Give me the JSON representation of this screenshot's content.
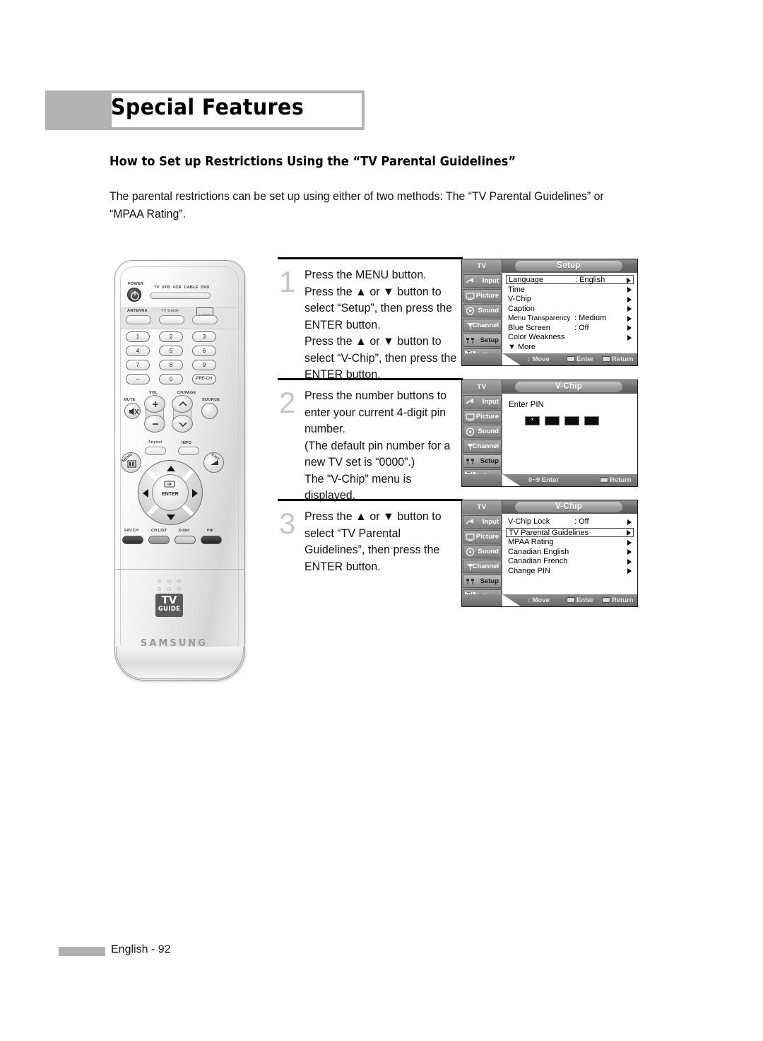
{
  "page": {
    "title": "Special Features",
    "section_heading": "How to Set up Restrictions Using the “TV Parental Guidelines”",
    "intro": "The parental restrictions can be set up using either of two methods: The “TV Parental Guidelines” or “MPAA Rating”.",
    "footer_text": "English - 92"
  },
  "remote": {
    "brand": "SAMSUNG",
    "power_label": "POWER",
    "device_modes": [
      "TV",
      "STB",
      "VCR",
      "CABLE",
      "DVD"
    ],
    "antenna_label": "ANTENNA",
    "tvguide_label": "TV Guide",
    "mode_label": "MODE",
    "numbers": [
      "1",
      "2",
      "3",
      "4",
      "5",
      "6",
      "7",
      "8",
      "9",
      "–",
      "0",
      "PRE-CH"
    ],
    "mute_label": "MUTE",
    "vol_label": "VOL",
    "chpage_label": "CH/PAGE",
    "source_label": "SOURCE",
    "anynet_label": "Anynet",
    "info_label": "INFO",
    "menu_label": "MENU",
    "exit_label": "EXIT",
    "enter_label": "ENTER",
    "color_buttons": [
      "FAV.CH",
      "CH.LIST",
      "D-Net",
      "PIP"
    ],
    "tvguide_logo_top": "TV",
    "tvguide_logo_bottom": "GUIDE"
  },
  "sidebar_items": [
    {
      "label": "Input",
      "icon": "input-icon"
    },
    {
      "label": "Picture",
      "icon": "picture-icon"
    },
    {
      "label": "Sound",
      "icon": "sound-icon"
    },
    {
      "label": "Channel",
      "icon": "channel-icon"
    },
    {
      "label": "Setup",
      "icon": "setup-icon"
    },
    {
      "label": "Listings",
      "icon": "listings-icon"
    }
  ],
  "steps": [
    {
      "number": "1",
      "text": "Press the MENU button.\nPress the ▲ or ▼ button to select “Setup”, then press the ENTER button.\nPress the ▲ or ▼ button to select “V-Chip”, then press the ENTER button."
    },
    {
      "number": "2",
      "text": "Press the number buttons to enter your current 4-digit pin number.\n(The default pin number for a new TV set is “0000”.)\nThe “V-Chip” menu is displayed."
    },
    {
      "number": "3",
      "text": "Press the ▲ or ▼ button to select “TV Parental Guidelines”, then press the ENTER button."
    }
  ],
  "osd_menus": [
    {
      "tv_tab": "TV",
      "title": "Setup",
      "active_sidebar": "Setup",
      "rows": [
        {
          "label": "Language",
          "value": ": English",
          "arrow": true,
          "selected": true
        },
        {
          "label": "Time",
          "value": "",
          "arrow": true,
          "selected": false
        },
        {
          "label": "V-Chip",
          "value": "",
          "arrow": true,
          "selected": false
        },
        {
          "label": "Caption",
          "value": "",
          "arrow": true,
          "selected": false
        },
        {
          "label": "Menu Transparency",
          "value": ": Medium",
          "arrow": true,
          "selected": false
        },
        {
          "label": "Blue Screen",
          "value": ": Off",
          "arrow": true,
          "selected": false
        },
        {
          "label": "Color Weakness",
          "value": "",
          "arrow": true,
          "selected": false
        }
      ],
      "more_label": "▼ More",
      "footer": [
        {
          "glyph": "updown",
          "label": "Move"
        },
        {
          "glyph": "enter",
          "label": "Enter"
        },
        {
          "glyph": "return",
          "label": "Return"
        }
      ]
    },
    {
      "tv_tab": "TV",
      "title": "V-Chip",
      "active_sidebar": "Setup",
      "pin_label": "Enter PIN",
      "pin_boxes": [
        "*",
        "",
        "",
        ""
      ],
      "footer": [
        {
          "glyph": "none",
          "label": "0~9 Enter"
        },
        {
          "glyph": "return",
          "label": "Return"
        }
      ]
    },
    {
      "tv_tab": "TV",
      "title": "V-Chip",
      "active_sidebar": "Setup",
      "rows": [
        {
          "label": "V-Chip Lock",
          "value": ": Off",
          "arrow": true,
          "selected": false
        },
        {
          "label": "TV Parental Guidelines",
          "value": "",
          "arrow": true,
          "selected": true
        },
        {
          "label": "MPAA Rating",
          "value": "",
          "arrow": true,
          "selected": false
        },
        {
          "label": "Canadian English",
          "value": "",
          "arrow": true,
          "selected": false
        },
        {
          "label": "Canadian French",
          "value": "",
          "arrow": true,
          "selected": false
        },
        {
          "label": "Change PIN",
          "value": "",
          "arrow": true,
          "selected": false
        }
      ],
      "footer": [
        {
          "glyph": "updown",
          "label": "Move"
        },
        {
          "glyph": "enter",
          "label": "Enter"
        },
        {
          "glyph": "return",
          "label": "Return"
        }
      ]
    }
  ],
  "colors": {
    "header_gray": "#b3b3b3",
    "step_number_gray": "#c6c6c6",
    "osd_dark": "#575757"
  }
}
